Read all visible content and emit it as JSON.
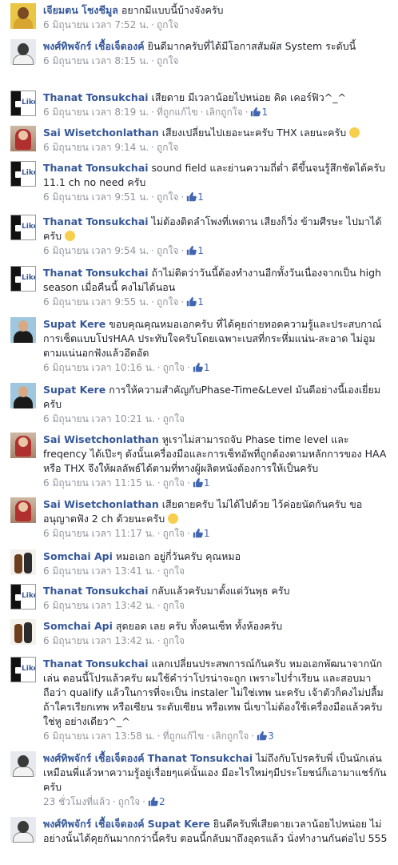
{
  "accent": "#365899",
  "meta_color": "#90949c",
  "comments": [
    {
      "name": "เจียมตน โชงชีมูล",
      "tag": "",
      "text": "อยากมีแบบนี้บ้างจังครับ",
      "date": "6 มิถุนายน เวลา 7:52 น.",
      "like": "ถูกใจ",
      "see_translation": "",
      "unlike": "",
      "count": "",
      "avatar": "yellow-person"
    },
    {
      "name": "พงศ์ทิพจักร์ เชื้อเจ็ดองค์",
      "tag": "",
      "text": "ยินดีมากครับที่ได้มีโอกาสสัมผัส System ระดับนี้",
      "date": "6 มิถุนายน เวลา 8:15 น.",
      "like": "ถูกใจ",
      "see_translation": "",
      "unlike": "",
      "count": "",
      "avatar": "man-glasses"
    },
    {
      "name": "Thanat Tonsukchai",
      "tag": "",
      "text": "เสียดาย มีเวลาน้อยไปหน่อย คิด เคอร์ฟิว^_^",
      "date": "6 มิถุนายน เวลา 8:19 น.",
      "like": "",
      "see_translation": "ที่ถูกแก้ไข",
      "unlike": "เลิกถูกใจ",
      "count": "1",
      "avatar": "like-logo"
    },
    {
      "name": "Sai Wisetchonlathan",
      "tag": "",
      "text": "เสียงเปลี่ยนไปเยอะนะครับ THX เลยนะครับ",
      "emoji": "smile",
      "date": "6 มิถุนายน เวลา 9:14 น.",
      "like": "ถูกใจ",
      "see_translation": "",
      "unlike": "",
      "count": "",
      "avatar": "red-person"
    },
    {
      "name": "Thanat Tonsukchai",
      "tag": "",
      "text": "sound field และย่านความถี่ต่ำ ดีขึ้นจนรู้สึกชัดได้ครับ 11.1 ch no need ครับ",
      "date": "6 มิถุนายน เวลา 9:51 น.",
      "like": "ถูกใจ",
      "see_translation": "",
      "unlike": "",
      "count": "1",
      "avatar": "like-logo"
    },
    {
      "name": "Thanat Tonsukchai",
      "tag": "",
      "text": "ไม่ต้องติดลำโพงที่เพดาน เสียงก็วิ่ง ข้ามศีรษะ ไปมาได้ครับ",
      "emoji": "smile",
      "date": "6 มิถุนายน เวลา 9:54 น.",
      "like": "ถูกใจ",
      "see_translation": "",
      "unlike": "",
      "count": "1",
      "avatar": "like-logo"
    },
    {
      "name": "Thanat Tonsukchai",
      "tag": "",
      "text": "ถ้าไม่ติดว่าวันนี้ต้องทำงานอีกทั้งวันเนื่องจากเป็น high season เมื่อคืนนี้ คงไม่ได้นอน",
      "date": "6 มิถุนายน เวลา 9:55 น.",
      "like": "ถูกใจ",
      "see_translation": "",
      "unlike": "",
      "count": "1",
      "avatar": "like-logo"
    },
    {
      "name": "Supat Kere",
      "tag": "",
      "text": "ขอบคุณคุณหมอเอกครับ ที่ได้คุยถ่ายทอดความรู้และประสบกาณ์การเซ็ตแบบโปรHAA ประทับใจครับโดยเฉพาะเบสที่กระหึ่มแน่น-สะอาด ไม่อูมตามแน่นอกฟังแล้วอึดอัด",
      "date": "6 มิถุนายน เวลา 10:16 น.",
      "like": "ถูกใจ",
      "see_translation": "",
      "unlike": "",
      "count": "1",
      "avatar": "supat"
    },
    {
      "name": "Supat Kere",
      "tag": "",
      "text": "การให้ความสำคัญกับPhase-Time&Level มันดีอย่างนี้เองเยี่ยมครับ",
      "date": "6 มิถุนายน เวลา 10:21 น.",
      "like": "ถูกใจ",
      "see_translation": "",
      "unlike": "",
      "count": "",
      "avatar": "supat"
    },
    {
      "name": "Sai Wisetchonlathan",
      "tag": "",
      "text": "หูเราไม่สามารถจับ Phase time level และ freqency ได้เป๊ะๆ ดังนั้นเครื่องมือและการเซ็ทอัพที่ถูกต้องตามหลักการของ HAA หรือ THX จึงให้ผลลัพธ์ได้ตามที่ทางผู้ผลิตหนังต้องการให้เป็นครับ",
      "date": "6 มิถุนายน เวลา 11:15 น.",
      "like": "ถูกใจ",
      "see_translation": "",
      "unlike": "",
      "count": "1",
      "avatar": "red-person"
    },
    {
      "name": "Sai Wisetchonlathan",
      "tag": "",
      "text": "เสียดายครับ ไม่ได้ไปด้วย ไว้ค่อยนัดกันครับ ขออนุญาตฟัง 2 ch ด้วยนะครับ",
      "emoji": "smile",
      "date": "6 มิถุนายน เวลา 11:17 น.",
      "like": "ถูกใจ",
      "see_translation": "",
      "unlike": "",
      "count": "1",
      "avatar": "red-person"
    },
    {
      "name": "Somchai Api",
      "tag": "",
      "text": "หมอเอก อยู่กี่วันครับ คุณหมอ",
      "date": "6 มิถุนายน เวลา 13:41 น.",
      "like": "ถูกใจ",
      "see_translation": "",
      "unlike": "",
      "count": "",
      "avatar": "api"
    },
    {
      "name": "Thanat Tonsukchai",
      "tag": "",
      "text": "กลับแล้วครับมาตั้งแต่วันพุธ ครับ",
      "date": "6 มิถุนายน เวลา 13:42 น.",
      "like": "ถูกใจ",
      "see_translation": "",
      "unlike": "",
      "count": "",
      "avatar": "like-logo"
    },
    {
      "name": "Somchai Api",
      "tag": "",
      "text": "สุดยอด เลย ครับ ทั้งคนเซ็ท ทั้งห้องครับ",
      "date": "6 มิถุนายน เวลา 13:42 น.",
      "like": "ถูกใจ",
      "see_translation": "",
      "unlike": "",
      "count": "",
      "avatar": "api"
    },
    {
      "name": "Thanat Tonsukchai",
      "tag": "",
      "text": "แลกเปลี่ยนประสพการณ์กันครับ หมอเอกพัฒนาจากนักเล่น ตอนนี้โปรแล้วครับ ผมใช้คำว่าโปรน่าจะถูก เพราะไปร่ำเรียน และสอบมา ถือว่า qualify แล้วในการที่จะเป็น instaler ไม่ใช่เทพ นะครับ เจ้าตัวก็คงไม่ปลื้มถ้าใครเรียกเทพ หรือเซียน ระดับเซียน หรือเทพ นี่เขาไม่ต้องใช้เครื่องมือแล้วครับ ใช่หู อย่างเดียว^_^",
      "date": "6 มิถุนายน เวลา 13:58 น.",
      "like": "",
      "see_translation": "ที่ถูกแก้ไข",
      "unlike": "เลิกถูกใจ",
      "count": "3",
      "avatar": "like-logo"
    },
    {
      "name": "พงศ์ทิพจักร์ เชื้อเจ็ดองค์",
      "tag": "Thanat Tonsukchai",
      "text": "ไม่ถึงกับโปรครับพี่ เป็นนักเล่นเหมือนพี่แล้วหาความรู้อยู่เรื่อยๆแค่นั้นเอง มีอะไรใหม่ๆมีประโยชน์ก็เอามาแชร์กันครับ",
      "date": "23 ชั่วโมงที่แล้ว",
      "like": "ถูกใจ",
      "see_translation": "",
      "unlike": "",
      "count": "2",
      "avatar": "man-glasses"
    },
    {
      "name": "พงศ์ทิพจักร์ เชื้อเจ็ดองค์",
      "tag": "Supat Kere",
      "text": "ยินดีครับพี่เสียดายเวลาน้อยไปหน่อย ไม่อย่างนั้นได้คุยกันมากกว่านี้ครับ ตอนนี้กลับมาถึงอุดรแล้ว นั่งทำงานกันต่อไป 555",
      "date": "",
      "like": "",
      "see_translation": "",
      "unlike": "",
      "count": "",
      "avatar": "man-glasses"
    }
  ]
}
